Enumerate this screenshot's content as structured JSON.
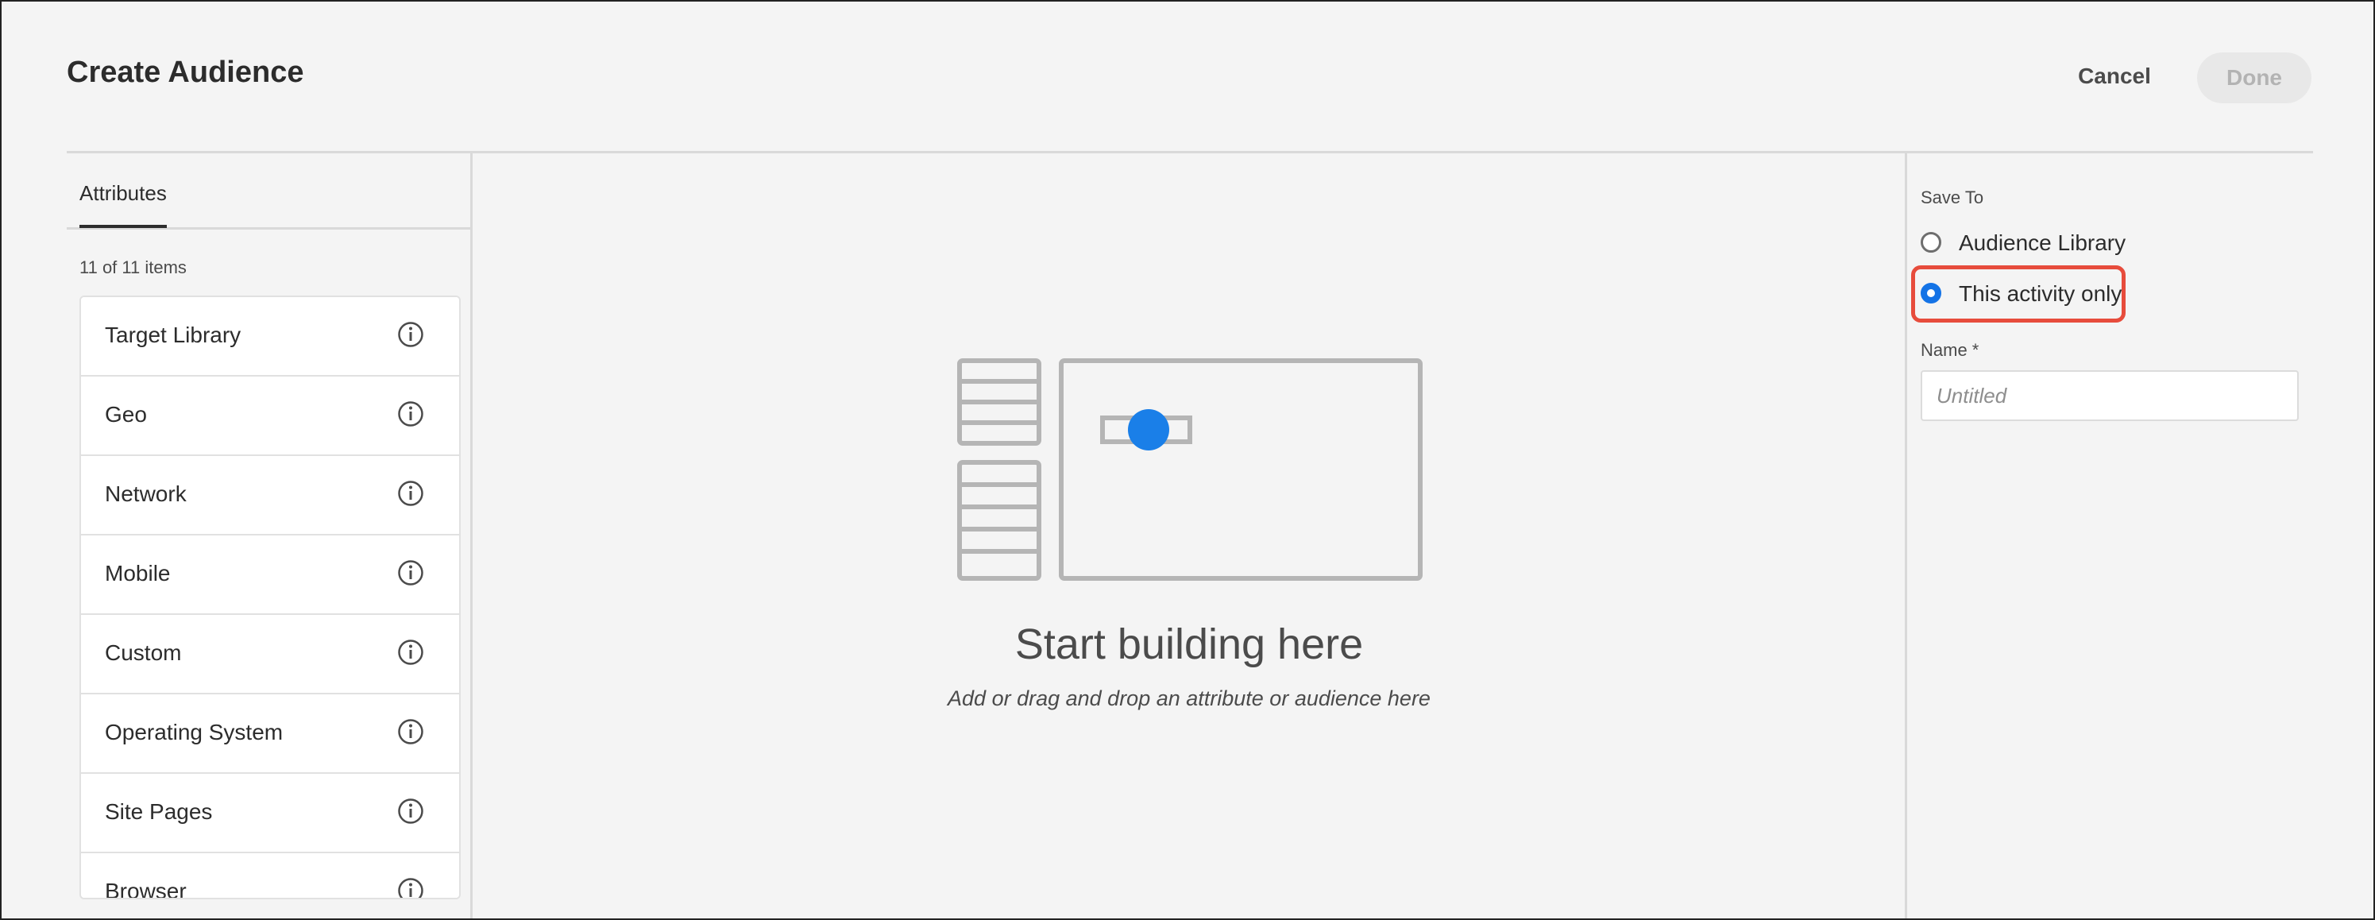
{
  "header": {
    "title": "Create Audience",
    "cancel_label": "Cancel",
    "done_label": "Done"
  },
  "attributes": {
    "tab_label": "Attributes",
    "count_text": "11 of 11 items",
    "items": [
      {
        "label": "Target Library",
        "icon": "info-icon"
      },
      {
        "label": "Geo",
        "icon": "info-icon"
      },
      {
        "label": "Network",
        "icon": "info-icon"
      },
      {
        "label": "Mobile",
        "icon": "info-icon"
      },
      {
        "label": "Custom",
        "icon": "info-icon"
      },
      {
        "label": "Operating System",
        "icon": "info-icon"
      },
      {
        "label": "Site Pages",
        "icon": "info-icon"
      },
      {
        "label": "Browser",
        "icon": "info-icon"
      }
    ]
  },
  "canvas": {
    "title": "Start building here",
    "subtitle": "Add or drag and drop an attribute or audience here"
  },
  "save_panel": {
    "save_to_label": "Save To",
    "options": [
      {
        "label": "Audience Library",
        "selected": false
      },
      {
        "label": "This activity only",
        "selected": true
      }
    ],
    "name_label": "Name *",
    "name_value": "",
    "name_placeholder": "Untitled"
  },
  "colors": {
    "accent": "#1473e6",
    "highlight": "#e74c3c",
    "background": "#f4f4f4"
  }
}
